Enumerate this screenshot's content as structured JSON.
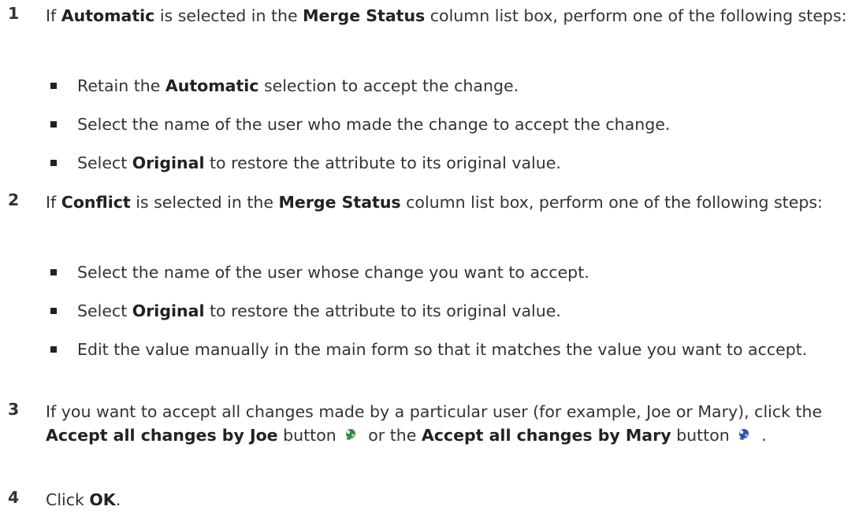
{
  "steps": [
    {
      "num": "1",
      "intro": {
        "t1": "If ",
        "b1": "Automatic",
        "t2": " is selected in the ",
        "b2": "Merge Status",
        "t3": " column list box, perform one of the following steps:"
      },
      "bullets": [
        {
          "t1": "Retain the ",
          "b1": "Automatic",
          "t2": " selection to accept the change."
        },
        {
          "t1": "Select the name of the user who made the change to accept the change."
        },
        {
          "t1": "Select ",
          "b1": "Original",
          "t2": " to restore the attribute to its original value."
        }
      ]
    },
    {
      "num": "2",
      "intro": {
        "t1": "If ",
        "b1": "Conflict",
        "t2": " is selected in the ",
        "b2": "Merge Status",
        "t3": " column list box, perform one of the following steps:"
      },
      "bullets": [
        {
          "t1": "Select the name of the user whose change you want to accept."
        },
        {
          "t1": "Select ",
          "b1": "Original",
          "t2": " to restore the attribute to its original value."
        },
        {
          "t1": "Edit the value manually in the main form so that it matches the value you want to accept."
        }
      ]
    },
    {
      "num": "3",
      "t1": "If you want to accept all changes made by a particular user (for example, Joe or Mary), click the ",
      "b1": "Accept all changes by Joe",
      "t2": " button",
      "t3": " or the ",
      "b2": "Accept all changes by Mary",
      "t4": " button",
      "t5": " ."
    },
    {
      "num": "4",
      "t1": "Click ",
      "b1": "OK",
      "t2": "."
    }
  ],
  "icons": {
    "joe": "accept-joe-icon",
    "mary": "accept-mary-icon",
    "joe_color": "#2e8b3a",
    "mary_color": "#2f4fa8"
  }
}
